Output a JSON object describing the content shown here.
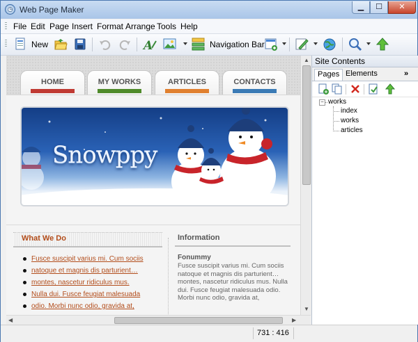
{
  "window": {
    "title": "Web Page Maker",
    "app_icon": "web-page-maker-logo-icon"
  },
  "menu": [
    {
      "label": "File"
    },
    {
      "label": "Edit"
    },
    {
      "label": "Page"
    },
    {
      "label": "Insert"
    },
    {
      "label": "Format"
    },
    {
      "label": "Arrange"
    },
    {
      "label": "Tools"
    },
    {
      "label": "Help"
    }
  ],
  "toolbar": {
    "new_label": "New",
    "navigation_bar_label": "Navigation Bar",
    "icons": [
      "new-page-icon",
      "open-folder-icon",
      "save-icon",
      "undo-icon",
      "redo-icon",
      "insert-text-icon",
      "insert-image-icon",
      "navigation-bar-icon",
      "insert-object-icon",
      "edit-pen-icon",
      "publish-globe-icon",
      "zoom-icon",
      "upload-arrow-icon"
    ]
  },
  "page": {
    "nav_tabs": [
      {
        "label": "HOME",
        "color": "#c03a33"
      },
      {
        "label": "MY WORKS",
        "color": "#4f8a2a"
      },
      {
        "label": "ARTICLES",
        "color": "#e0802f"
      },
      {
        "label": "CONTACTS",
        "color": "#3b7bb5"
      }
    ],
    "banner_text": "Snowppy",
    "what_we_do": {
      "title": "What We Do",
      "links": [
        "Fusce suscipit varius mi. Cum sociis",
        "natoque et magnis dis parturient…",
        "montes, nascetur ridiculus mus.",
        "Nulla dui. Fusce feugiat malesuada",
        "odio. Morbi nunc odio, gravida at,"
      ]
    },
    "information": {
      "title": "Information",
      "subtitle": "Fonummy",
      "body": "Fusce suscipit varius mi. Cum sociis natoque et magnis dis parturient… montes, nascetur ridiculus mus. Nulla dui. Fusce feugiat malesuada odio. Morbi nunc odio, gravida at,"
    }
  },
  "status": {
    "coords": "731 : 416"
  },
  "site_contents": {
    "title": "Site Contents",
    "tabs": [
      {
        "label": "Pages"
      },
      {
        "label": "Elements"
      }
    ],
    "more": "»",
    "tree": {
      "root": "works",
      "children": [
        "index",
        "works",
        "articles"
      ]
    }
  }
}
